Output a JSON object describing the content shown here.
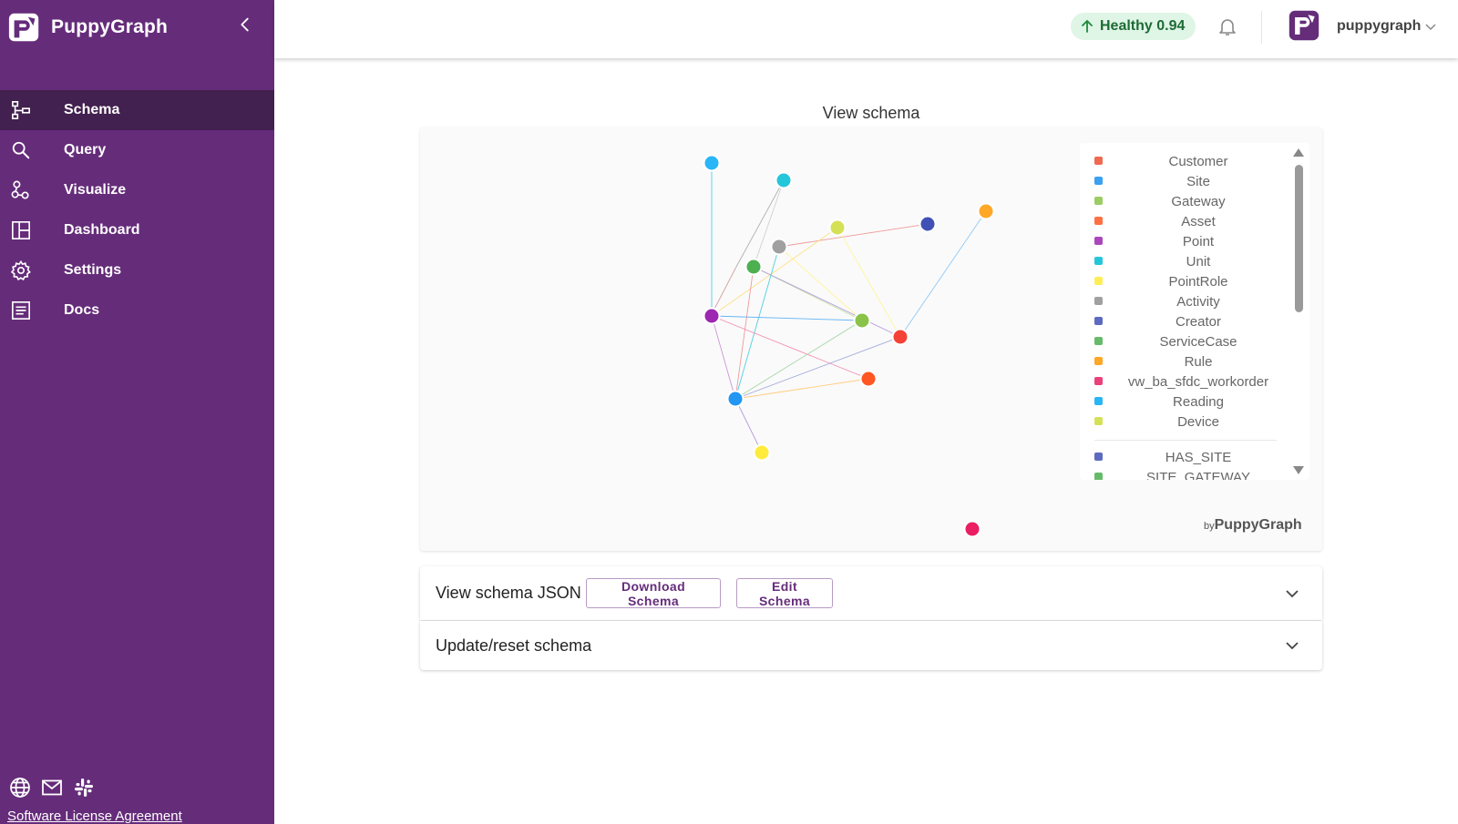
{
  "app": {
    "name": "PuppyGraph"
  },
  "sidebar": {
    "items": [
      {
        "label": "Schema",
        "icon": "schema-icon",
        "active": true
      },
      {
        "label": "Query",
        "icon": "search-icon",
        "active": false
      },
      {
        "label": "Visualize",
        "icon": "visualize-icon",
        "active": false
      },
      {
        "label": "Dashboard",
        "icon": "dashboard-icon",
        "active": false
      },
      {
        "label": "Settings",
        "icon": "gear-icon",
        "active": false
      },
      {
        "label": "Docs",
        "icon": "docs-icon",
        "active": false
      }
    ],
    "footer_icons": [
      "globe-icon",
      "mail-icon",
      "slack-icon"
    ],
    "license_link": "Software License Agreement"
  },
  "topbar": {
    "health": "Healthy 0.94",
    "user": "puppygraph"
  },
  "main": {
    "title": "View schema",
    "watermark_by": "by",
    "watermark_brand": "PuppyGraph",
    "legend": {
      "vertices": [
        {
          "label": "Customer",
          "color": "#ee6a50"
        },
        {
          "label": "Site",
          "color": "#3aa0f0"
        },
        {
          "label": "Gateway",
          "color": "#9ccc65"
        },
        {
          "label": "Asset",
          "color": "#ff7043"
        },
        {
          "label": "Point",
          "color": "#ab47bc"
        },
        {
          "label": "Unit",
          "color": "#26c6da"
        },
        {
          "label": "PointRole",
          "color": "#ffee58"
        },
        {
          "label": "Activity",
          "color": "#a0a0a0"
        },
        {
          "label": "Creator",
          "color": "#5c6bc0"
        },
        {
          "label": "ServiceCase",
          "color": "#66bb6a"
        },
        {
          "label": "Rule",
          "color": "#ffa726"
        },
        {
          "label": "vw_ba_sfdc_workorder",
          "color": "#ec407a"
        },
        {
          "label": "Reading",
          "color": "#29b6f6"
        },
        {
          "label": "Device",
          "color": "#d4e157"
        }
      ],
      "edges": [
        {
          "label": "HAS_SITE",
          "color": "#5c6bc0"
        },
        {
          "label": "SITE_GATEWAY",
          "color": "#66bb6a"
        }
      ]
    },
    "accordions": [
      {
        "title": "View schema JSON",
        "download_label": "Download Schema",
        "edit_label": "Edit Schema"
      },
      {
        "title": "Update/reset schema"
      }
    ]
  }
}
